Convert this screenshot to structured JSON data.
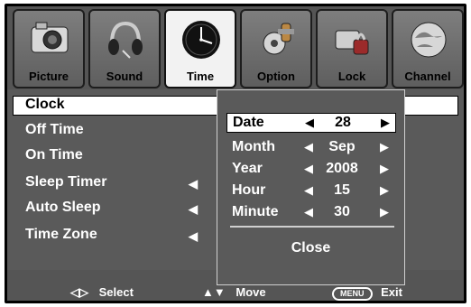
{
  "tabs": [
    {
      "id": "picture",
      "label": "Picture",
      "icon": "camera-icon",
      "active": false
    },
    {
      "id": "sound",
      "label": "Sound",
      "icon": "headphones-icon",
      "active": false
    },
    {
      "id": "time",
      "label": "Time",
      "icon": "clock-icon",
      "active": true
    },
    {
      "id": "option",
      "label": "Option",
      "icon": "gear-icon",
      "active": false
    },
    {
      "id": "lock",
      "label": "Lock",
      "icon": "key-icon",
      "active": false
    },
    {
      "id": "channel",
      "label": "Channel",
      "icon": "globe-icon",
      "active": false
    }
  ],
  "menu": {
    "items": [
      {
        "label": "Clock",
        "selected": true,
        "has_arrow": false
      },
      {
        "label": "Off Time",
        "selected": false,
        "has_arrow": false
      },
      {
        "label": "On Time",
        "selected": false,
        "has_arrow": false
      },
      {
        "label": "Sleep Timer",
        "selected": false,
        "has_arrow": true
      },
      {
        "label": "Auto Sleep",
        "selected": false,
        "has_arrow": true
      },
      {
        "label": "Time Zone",
        "selected": false,
        "has_arrow": true
      }
    ],
    "left_arrow_symbol": "◀"
  },
  "clock_popup": {
    "rows": [
      {
        "key": "Date",
        "value": "28",
        "selected": true
      },
      {
        "key": "Month",
        "value": "Sep",
        "selected": false
      },
      {
        "key": "Year",
        "value": "2008",
        "selected": false
      },
      {
        "key": "Hour",
        "value": "15",
        "selected": false
      },
      {
        "key": "Minute",
        "value": "30",
        "selected": false
      }
    ],
    "left_arrow": "◀",
    "right_arrow": "▶",
    "close_label": "Close"
  },
  "hints": {
    "select_symbol": "◁▷",
    "select_label": "Select",
    "move_symbol": "▲▼",
    "move_label": "Move",
    "menu_button": "MENU",
    "exit_label": "Exit"
  }
}
